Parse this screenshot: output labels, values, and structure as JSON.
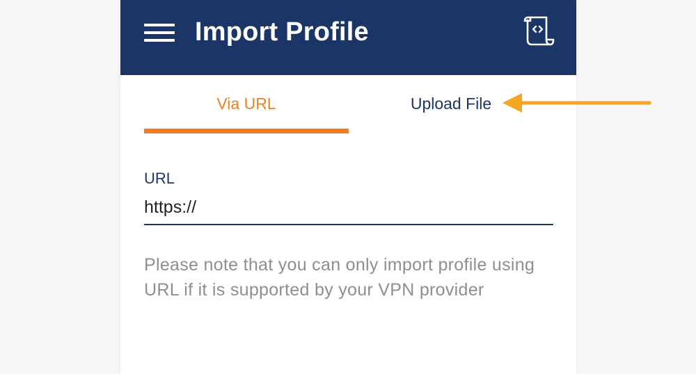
{
  "header": {
    "title": "Import Profile",
    "menu_icon": "hamburger-menu-icon",
    "action_icon": "log-scroll-icon"
  },
  "tabs": [
    {
      "label": "Via URL",
      "active": true
    },
    {
      "label": "Upload File",
      "active": false
    }
  ],
  "form": {
    "url_label": "URL",
    "url_value": "https://"
  },
  "hint": "Please note that you can only import profile using URL if it is supported by your VPN provider",
  "annotation": {
    "icon": "arrow-left-icon"
  },
  "colors": {
    "app_bar": "#1b3566",
    "accent": "#ee7e22",
    "annotation_arrow": "#f5a623",
    "hint_text": "#8e8e8e",
    "background": "#f6f6f6"
  }
}
